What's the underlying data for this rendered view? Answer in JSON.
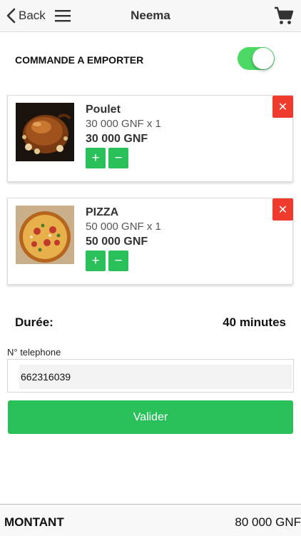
{
  "header": {
    "back_label": "Back",
    "title": "Neema"
  },
  "takeaway": {
    "label": "COMMANDE A EMPORTER",
    "enabled": true
  },
  "items": [
    {
      "name": "Poulet",
      "unit_line": "30 000 GNF x 1",
      "total": "30 000 GNF",
      "plus": "+",
      "minus": "−",
      "remove": "✕"
    },
    {
      "name": "PIZZA",
      "unit_line": "50 000 GNF x 1",
      "total": "50 000 GNF",
      "plus": "+",
      "minus": "−",
      "remove": "✕"
    }
  ],
  "duration": {
    "label": "Durée:",
    "value": "40 minutes"
  },
  "phone": {
    "label": "N° telephone",
    "value": "662316039"
  },
  "validate_label": "Valider",
  "footer": {
    "label": "MONTANT",
    "amount": "80 000 GNF"
  },
  "colors": {
    "accent_green": "#29c05a",
    "toggle_green": "#4cd964",
    "remove_red": "#ef3b2d"
  }
}
